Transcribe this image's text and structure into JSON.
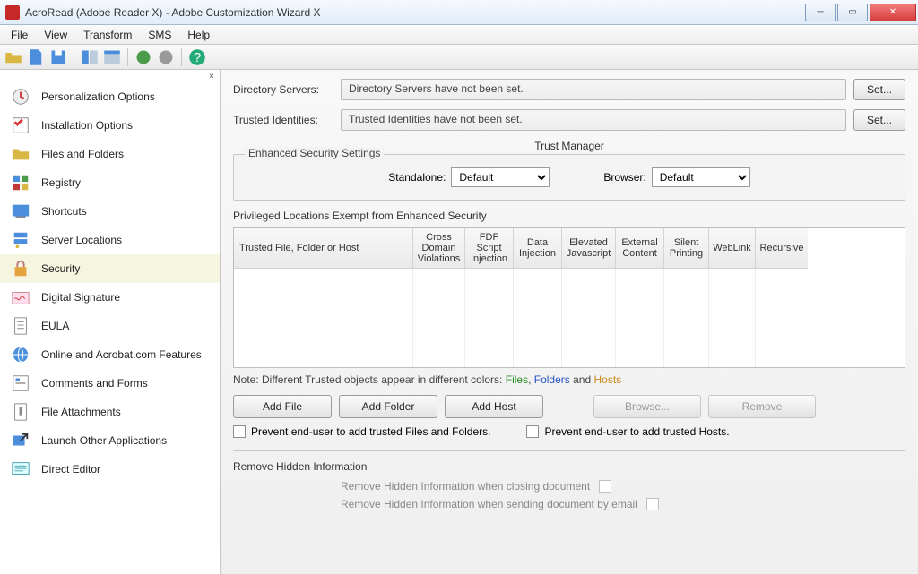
{
  "window": {
    "title": "AcroRead (Adobe Reader X) - Adobe Customization Wizard X"
  },
  "menu": {
    "file": "File",
    "view": "View",
    "transform": "Transform",
    "sms": "SMS",
    "help": "Help"
  },
  "sidebar": {
    "items": [
      {
        "label": "Personalization Options"
      },
      {
        "label": "Installation Options"
      },
      {
        "label": "Files and Folders"
      },
      {
        "label": "Registry"
      },
      {
        "label": "Shortcuts"
      },
      {
        "label": "Server Locations"
      },
      {
        "label": "Security"
      },
      {
        "label": "Digital Signature"
      },
      {
        "label": "EULA"
      },
      {
        "label": "Online and Acrobat.com Features"
      },
      {
        "label": "Comments and Forms"
      },
      {
        "label": "File Attachments"
      },
      {
        "label": "Launch Other Applications"
      },
      {
        "label": "Direct Editor"
      }
    ]
  },
  "main": {
    "dir_label": "Directory Servers:",
    "dir_value": "Directory Servers have not been set.",
    "trusted_label": "Trusted Identities:",
    "trusted_value": "Trusted Identities have not been set.",
    "set_btn": "Set...",
    "trust_manager_title": "Trust Manager",
    "enh_sec_title": "Enhanced Security Settings",
    "standalone_label": "Standalone:",
    "browser_label": "Browser:",
    "default_option": "Default",
    "priv_title": "Privileged Locations Exempt from Enhanced Security",
    "headers": [
      "Trusted File, Folder or Host",
      "Cross Domain Violations",
      "FDF Script Injection",
      "Data Injection",
      "Elevated Javascript",
      "External Content",
      "Silent Printing",
      "WebLink",
      "Recursive"
    ],
    "note_text": "Note: Different Trusted objects appear in different colors:",
    "note_files": "Files",
    "note_folders": "Folders",
    "note_and": "and",
    "note_hosts": "Hosts",
    "btn_addfile": "Add File",
    "btn_addfolder": "Add Folder",
    "btn_addhost": "Add Host",
    "btn_browse": "Browse...",
    "btn_remove": "Remove",
    "ck_prevent_files": "Prevent end-user to add trusted Files and Folders.",
    "ck_prevent_hosts": "Prevent end-user to add trusted Hosts.",
    "rm_title": "Remove Hidden Information",
    "rm_closing": "Remove Hidden Information when closing document",
    "rm_email": "Remove Hidden Information when sending document by email"
  }
}
